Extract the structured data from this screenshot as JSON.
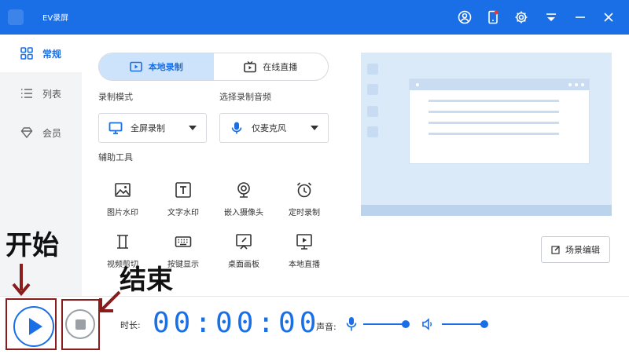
{
  "app": {
    "title": "EV录屏"
  },
  "colors": {
    "accent": "#1a6fe6",
    "annotation": "#8b1c1c"
  },
  "titlebar_icons": [
    "user-icon",
    "phone-icon",
    "gear-icon",
    "dropdown-icon",
    "minimize-icon",
    "close-icon"
  ],
  "sidebar": {
    "items": [
      {
        "label": "常规",
        "icon": "grid-icon",
        "active": true
      },
      {
        "label": "列表",
        "icon": "list-icon",
        "active": false
      },
      {
        "label": "会员",
        "icon": "diamond-icon",
        "active": false
      }
    ]
  },
  "mode_tabs": [
    {
      "label": "本地录制",
      "icon": "local-record-icon",
      "active": true
    },
    {
      "label": "在线直播",
      "icon": "tv-icon",
      "active": false
    }
  ],
  "record_mode": {
    "label": "录制模式",
    "value": "全屏录制",
    "icon": "monitor-icon"
  },
  "audio": {
    "label": "选择录制音频",
    "value": "仅麦克风",
    "icon": "mic-icon"
  },
  "tools": {
    "label": "辅助工具",
    "items": [
      {
        "label": "图片水印",
        "icon": "image-icon"
      },
      {
        "label": "文字水印",
        "icon": "text-icon"
      },
      {
        "label": "嵌入摄像头",
        "icon": "webcam-icon"
      },
      {
        "label": "定时录制",
        "icon": "alarm-icon"
      },
      {
        "label": "视频剪切",
        "icon": "cut-icon"
      },
      {
        "label": "按键显示",
        "icon": "keyboard-icon"
      },
      {
        "label": "桌面画板",
        "icon": "board-icon"
      },
      {
        "label": "本地直播",
        "icon": "screen-play-icon"
      }
    ]
  },
  "scene_button": {
    "label": "场景编辑"
  },
  "bottom": {
    "duration_label": "时长:",
    "timer": "00:00:00",
    "volume_label": "声音:",
    "mic_level": 0.9,
    "speaker_level": 0.9
  },
  "annotations": {
    "start": "开始",
    "stop": "结束"
  }
}
